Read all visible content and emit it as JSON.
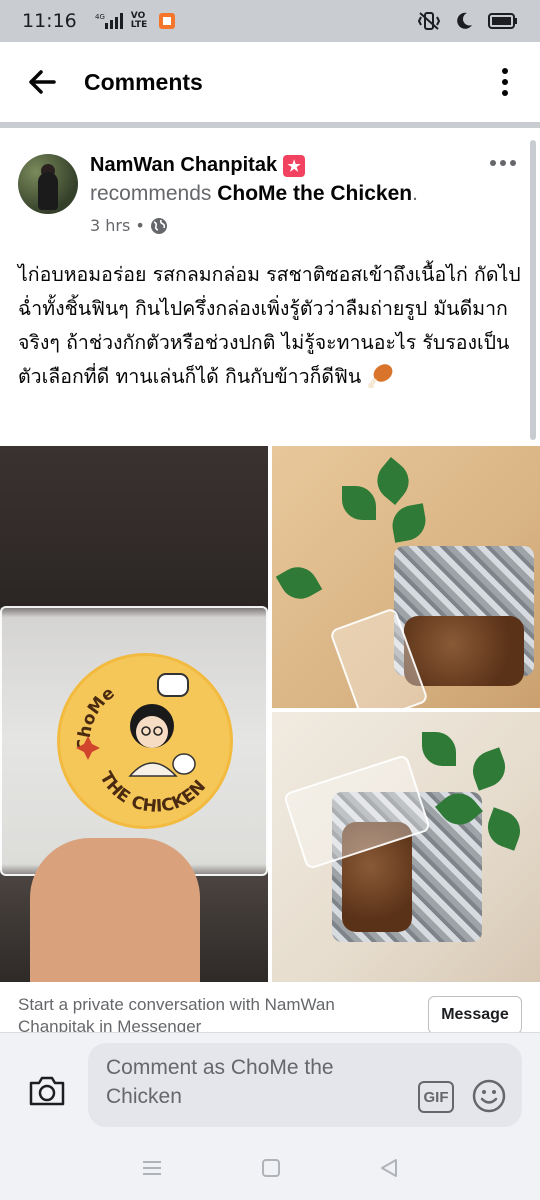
{
  "status_bar": {
    "time": "11:16",
    "network": "4G",
    "volte": "VO LTE"
  },
  "header": {
    "title": "Comments"
  },
  "post": {
    "author": "NamWan Chanpitak",
    "action": "recommends",
    "page": "ChoMe the Chicken",
    "page_suffix": ".",
    "time": "3 hrs",
    "separator": "•",
    "text": "ไก่อบหอมอร่อย รสกลมกล่อม รสชาติซอสเข้าถึงเนื้อไก่ กัดไปฉ่ำทั้งชิ้นฟินๆ กินไปครึ่งกล่องเพิ่งรู้ตัวว่าลืมถ่ายรูป มันดีมากจริงๆ ถ้าช่วงกักตัวหรือช่วงปกติ ไม่รู้จะทานอะไร รับรองเป็นตัวเลือกที่ดี ทานเล่นก็ได้ กินกับข้าวก็ดีฟิน",
    "sticker_text_top": "ChoMe",
    "sticker_text_bottom": "THE CHICKEN"
  },
  "messenger_cta": {
    "text": "Start a private conversation with NamWan Chanpitak in Messenger",
    "button": "Message"
  },
  "composer": {
    "placeholder": "Comment as ChoMe the Chicken",
    "gif_label": "GIF"
  },
  "colors": {
    "accent_pink": "#f3425f",
    "status_bar": "#c9ccd1",
    "text_primary": "#050505",
    "text_secondary": "#65676b"
  },
  "icons": {
    "back": "arrow-left-icon",
    "more": "more-vertical-icon",
    "post_more": "more-horizontal-icon",
    "privacy": "globe-icon",
    "camera": "camera-icon",
    "gif": "gif-icon",
    "emoji": "smile-icon"
  }
}
